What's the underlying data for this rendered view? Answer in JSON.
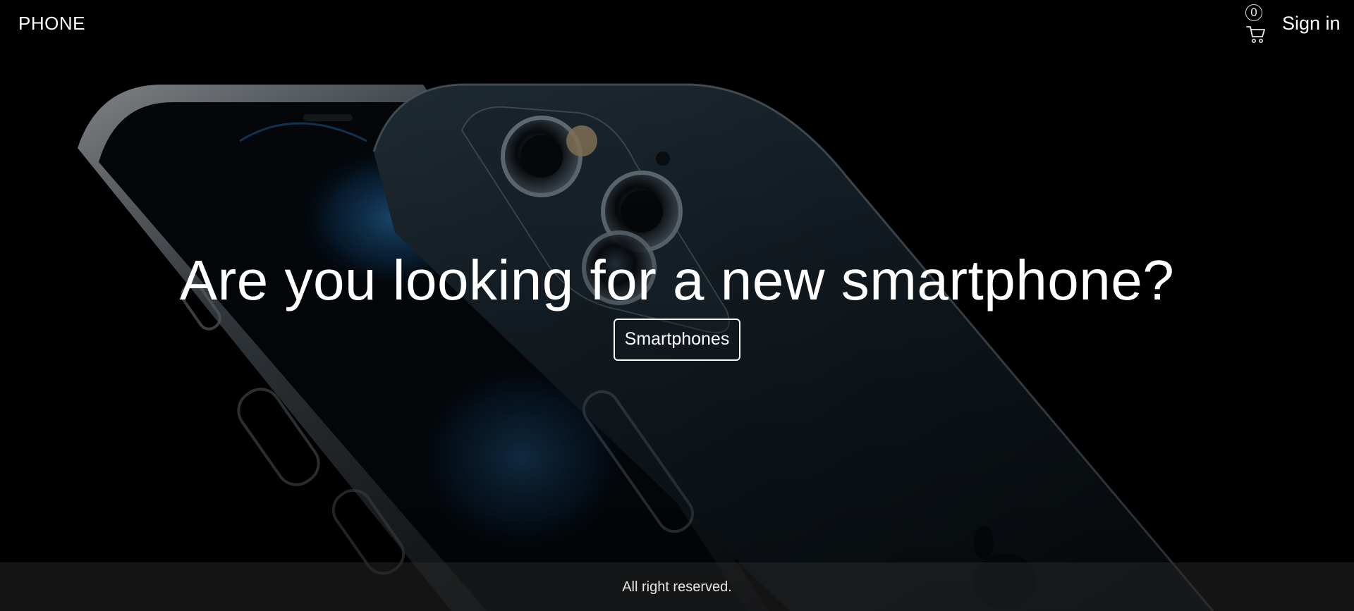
{
  "header": {
    "brand": "PHONE",
    "cart_count": "0",
    "signin_label": "Sign in"
  },
  "hero": {
    "headline": "Are you looking for a new smartphone?",
    "cta_label": "Smartphones"
  },
  "footer": {
    "text": "All right reserved."
  },
  "icons": {
    "cart": "shopping-cart-icon"
  },
  "colors": {
    "background": "#000000",
    "text": "#ffffff",
    "phone_body": "#1c2a33",
    "phone_frame": "#7f8a93",
    "screen_glow": "#1f5f97"
  }
}
